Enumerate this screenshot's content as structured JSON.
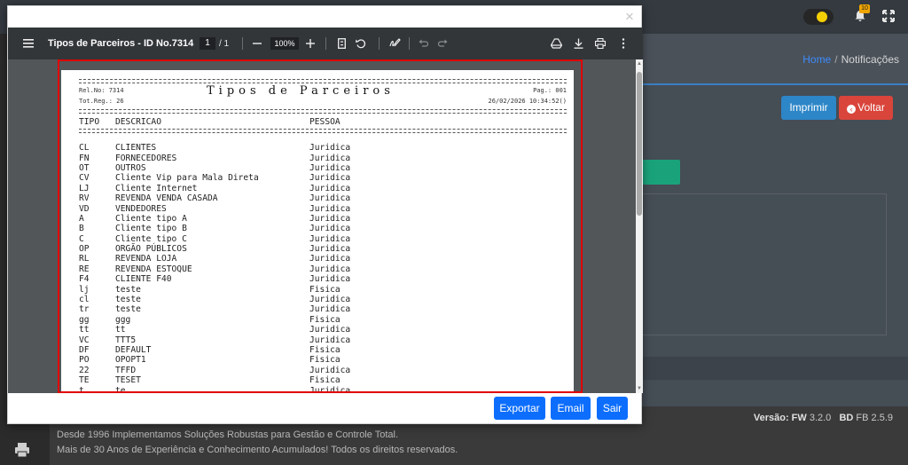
{
  "background": {
    "breadcrumb": {
      "home": "Home",
      "separator": "/",
      "current": "Notificações"
    },
    "buttons": {
      "print": "Imprimir",
      "back": "Voltar"
    },
    "notifications_badge": "10",
    "version": {
      "fw_label": "Versão: FW",
      "fw_value": "3.2.0",
      "bd_label": "BD",
      "bd_value": "FB 2.5.9"
    },
    "footer": {
      "line1": "Desde 1996 Implementamos Soluções Robustas para Gestão e Controle Total.",
      "line2": "Mais de 30 Anos de Experiência e Conhecimento Acumulados! Todos os direitos reservados."
    }
  },
  "modal": {
    "close_label": "×",
    "viewer": {
      "title": "Tipos de Parceiros - ID No.7314",
      "page_current": "1",
      "page_total": "/ 1",
      "zoom": "100%",
      "icons": [
        "menu-icon",
        "zoom-out-icon",
        "zoom-in-icon",
        "fit-page-icon",
        "rotate-icon",
        "annotate-icon",
        "undo-icon",
        "redo-icon",
        "drive-icon",
        "download-icon",
        "print-icon",
        "more-icon"
      ]
    },
    "report": {
      "title": "Tipos de Parceiros",
      "rel_no": "Rel.No: 7314",
      "tot_reg": "Tot.Reg.: 26",
      "page": "Pag.: 001",
      "datetime": "26/02/2026 10:34:52()",
      "headers": {
        "tipo": "TIPO",
        "descricao": "DESCRICAO",
        "pessoa": "PESSOA"
      },
      "rows": [
        {
          "tipo": "CL",
          "descricao": "CLIENTES",
          "pessoa": "Juridica"
        },
        {
          "tipo": "FN",
          "descricao": "FORNECEDORES",
          "pessoa": "Juridica"
        },
        {
          "tipo": "OT",
          "descricao": "OUTROS",
          "pessoa": "Juridica"
        },
        {
          "tipo": "CV",
          "descricao": "Cliente Vip para Mala Direta",
          "pessoa": "Juridica"
        },
        {
          "tipo": "LJ",
          "descricao": "Cliente Internet",
          "pessoa": "Juridica"
        },
        {
          "tipo": "RV",
          "descricao": "REVENDA VENDA CASADA",
          "pessoa": "Juridica"
        },
        {
          "tipo": "VD",
          "descricao": "VENDEDORES",
          "pessoa": "Juridica"
        },
        {
          "tipo": "A",
          "descricao": "Cliente tipo A",
          "pessoa": "Juridica"
        },
        {
          "tipo": "B",
          "descricao": "Cliente tipo B",
          "pessoa": "Juridica"
        },
        {
          "tipo": "C",
          "descricao": "Cliente tipo C",
          "pessoa": "Juridica"
        },
        {
          "tipo": "OP",
          "descricao": "ORGÃO PÚBLICOS",
          "pessoa": "Juridica"
        },
        {
          "tipo": "RL",
          "descricao": "REVENDA LOJA",
          "pessoa": "Juridica"
        },
        {
          "tipo": "RE",
          "descricao": "REVENDA ESTOQUE",
          "pessoa": "Juridica"
        },
        {
          "tipo": "F4",
          "descricao": "CLIENTE F40",
          "pessoa": "Juridica"
        },
        {
          "tipo": "lj",
          "descricao": "teste",
          "pessoa": "Fisica"
        },
        {
          "tipo": "cl",
          "descricao": "teste",
          "pessoa": "Juridica"
        },
        {
          "tipo": "tr",
          "descricao": "teste",
          "pessoa": "Juridica"
        },
        {
          "tipo": "gg",
          "descricao": "ggg",
          "pessoa": "Fisica"
        },
        {
          "tipo": "tt",
          "descricao": "tt",
          "pessoa": "Juridica"
        },
        {
          "tipo": "VC",
          "descricao": "TTT5",
          "pessoa": "Juridica"
        },
        {
          "tipo": "DF",
          "descricao": "DEFAULT",
          "pessoa": "Fisica"
        },
        {
          "tipo": "PO",
          "descricao": "OPOPT1",
          "pessoa": "Fisica"
        },
        {
          "tipo": "22",
          "descricao": "TFFD",
          "pessoa": "Juridica"
        },
        {
          "tipo": "TE",
          "descricao": "TESET",
          "pessoa": "Fisica"
        },
        {
          "tipo": "t",
          "descricao": "te",
          "pessoa": "Juridica"
        }
      ]
    },
    "footer_buttons": {
      "export": "Exportar",
      "email": "Email",
      "exit": "Sair"
    }
  },
  "colors": {
    "primary": "#0d6efd",
    "danger": "#d9453b",
    "highlight": "#e00000",
    "success": "#1aa37a"
  }
}
